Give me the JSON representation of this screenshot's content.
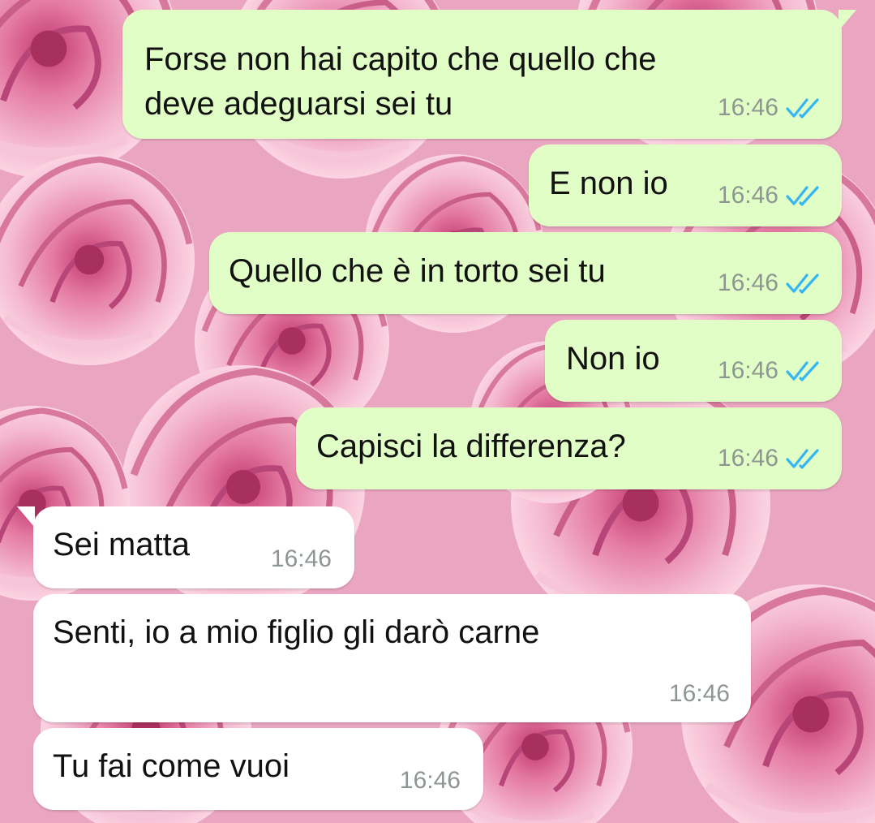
{
  "messages": [
    {
      "direction": "outgoing",
      "text_lines": [
        "Forse non hai capito che quello che",
        "deve adeguarsi sei tu"
      ],
      "time": "16:46",
      "status": "read"
    },
    {
      "direction": "outgoing",
      "text": "E non io",
      "time": "16:46",
      "status": "read"
    },
    {
      "direction": "outgoing",
      "text": "Quello che è in torto sei tu",
      "time": "16:46",
      "status": "read"
    },
    {
      "direction": "outgoing",
      "text": "Non io",
      "time": "16:46",
      "status": "read"
    },
    {
      "direction": "outgoing",
      "text": "Capisci la differenza?",
      "time": "16:46",
      "status": "read"
    },
    {
      "direction": "incoming",
      "text": "Sei matta",
      "time": "16:46"
    },
    {
      "direction": "incoming",
      "text": "Senti, io a mio figlio gli darò carne",
      "time": "16:46"
    },
    {
      "direction": "incoming",
      "text": "Tu fai come vuoi",
      "time": "16:46"
    }
  ],
  "icons": {
    "read_receipt": "double-check-icon",
    "wallpaper": "pink-roses"
  },
  "colors": {
    "outgoing_bubble": "#e1fec6",
    "incoming_bubble": "#ffffff",
    "timestamp": "#8d9692",
    "read_tick": "#34b7f1",
    "wallpaper_pink": "#e9a3be"
  }
}
